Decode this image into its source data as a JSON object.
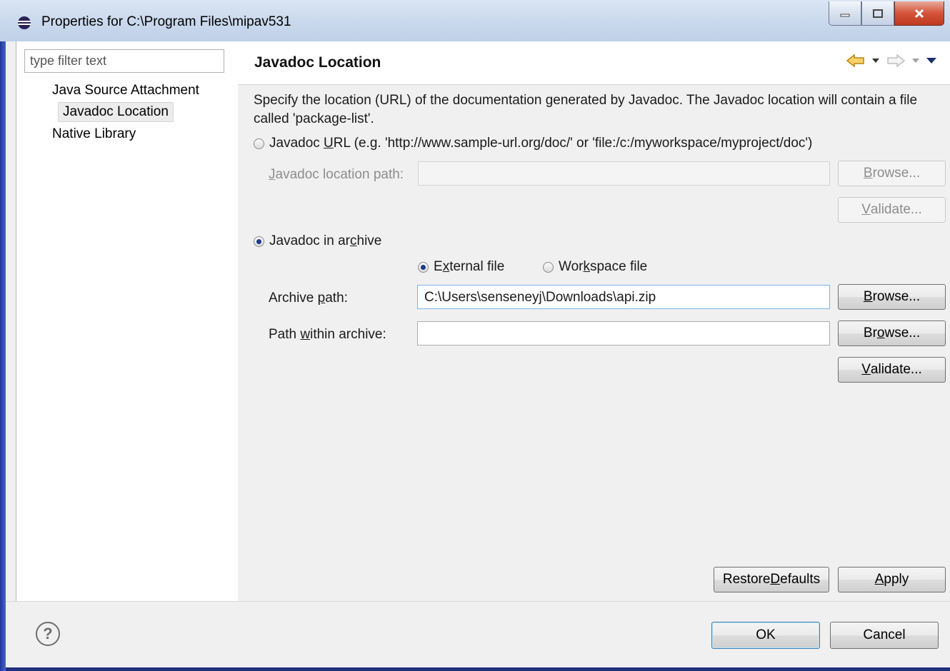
{
  "window": {
    "title": "Properties for C:\\Program Files\\mipav531"
  },
  "left": {
    "filter_placeholder": "type filter text",
    "items": [
      {
        "label": "Java Source Attachment",
        "selected": false
      },
      {
        "label": "Javadoc Location",
        "selected": true
      },
      {
        "label": "Native Library",
        "selected": false
      }
    ]
  },
  "page": {
    "title": "Javadoc Location",
    "description": "Specify the location (URL) of the documentation generated by Javadoc. The Javadoc location will contain a file called 'package-list'.",
    "url_option": {
      "pre": "Javadoc ",
      "u": "U",
      "post": "RL (e.g. 'http://www.sample-url.org/doc/' or 'file:/c:/myworkspace/myproject/doc')",
      "checked": false
    },
    "location_label": {
      "u": "J",
      "post": "avadoc location path:"
    },
    "location_value": "",
    "browse1": {
      "u": "B",
      "post": "rowse..."
    },
    "validate1": {
      "u": "V",
      "post": "alidate..."
    },
    "archive_option": {
      "pre": "Javadoc in ar",
      "u": "c",
      "post": "hive",
      "checked": true
    },
    "external_file": {
      "pre": "E",
      "u": "x",
      "post": "ternal file",
      "checked": true
    },
    "workspace_file": {
      "pre": "Wor",
      "u": "k",
      "post": "space file",
      "checked": false
    },
    "archive_path_label": {
      "pre": "Archive ",
      "u": "p",
      "post": "ath:"
    },
    "archive_path_value": "C:\\Users\\senseneyj\\Downloads\\api.zip",
    "browse2": {
      "u": "B",
      "post": "rowse..."
    },
    "within_label": {
      "pre": "Path ",
      "u": "w",
      "post": "ithin archive:"
    },
    "within_value": "",
    "browse3": {
      "pre": "Br",
      "u": "o",
      "post": "wse..."
    },
    "validate2": {
      "u": "V",
      "post": "alidate..."
    },
    "restore": {
      "pre": "Restore ",
      "u": "D",
      "post": "efaults"
    },
    "apply": {
      "u": "A",
      "post": "pply"
    }
  },
  "footer": {
    "help_symbol": "?",
    "ok": "OK",
    "cancel": "Cancel"
  }
}
